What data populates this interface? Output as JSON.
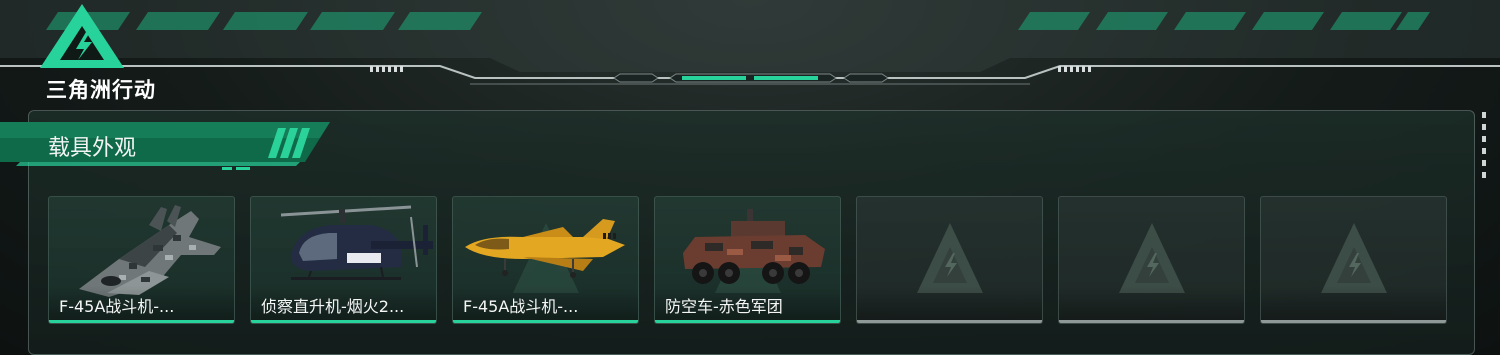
{
  "game": {
    "logo_text": "三角洲行动"
  },
  "section": {
    "title": "载具外观"
  },
  "colors": {
    "accent": "#27d39b",
    "empty_bar": "#8f9997"
  },
  "items": [
    {
      "name": "F-45A战斗机-...",
      "icon": "fighter-jet-camo-icon"
    },
    {
      "name": "侦察直升机-烟火2...",
      "icon": "scout-helicopter-icon"
    },
    {
      "name": "F-45A战斗机-...",
      "icon": "fighter-jet-yellow-icon"
    },
    {
      "name": "防空车-赤色军团",
      "icon": "anti-air-vehicle-icon"
    },
    {
      "name": "",
      "icon": "empty-slot-logo-icon"
    },
    {
      "name": "",
      "icon": "empty-slot-logo-icon"
    },
    {
      "name": "",
      "icon": "empty-slot-logo-icon"
    }
  ]
}
